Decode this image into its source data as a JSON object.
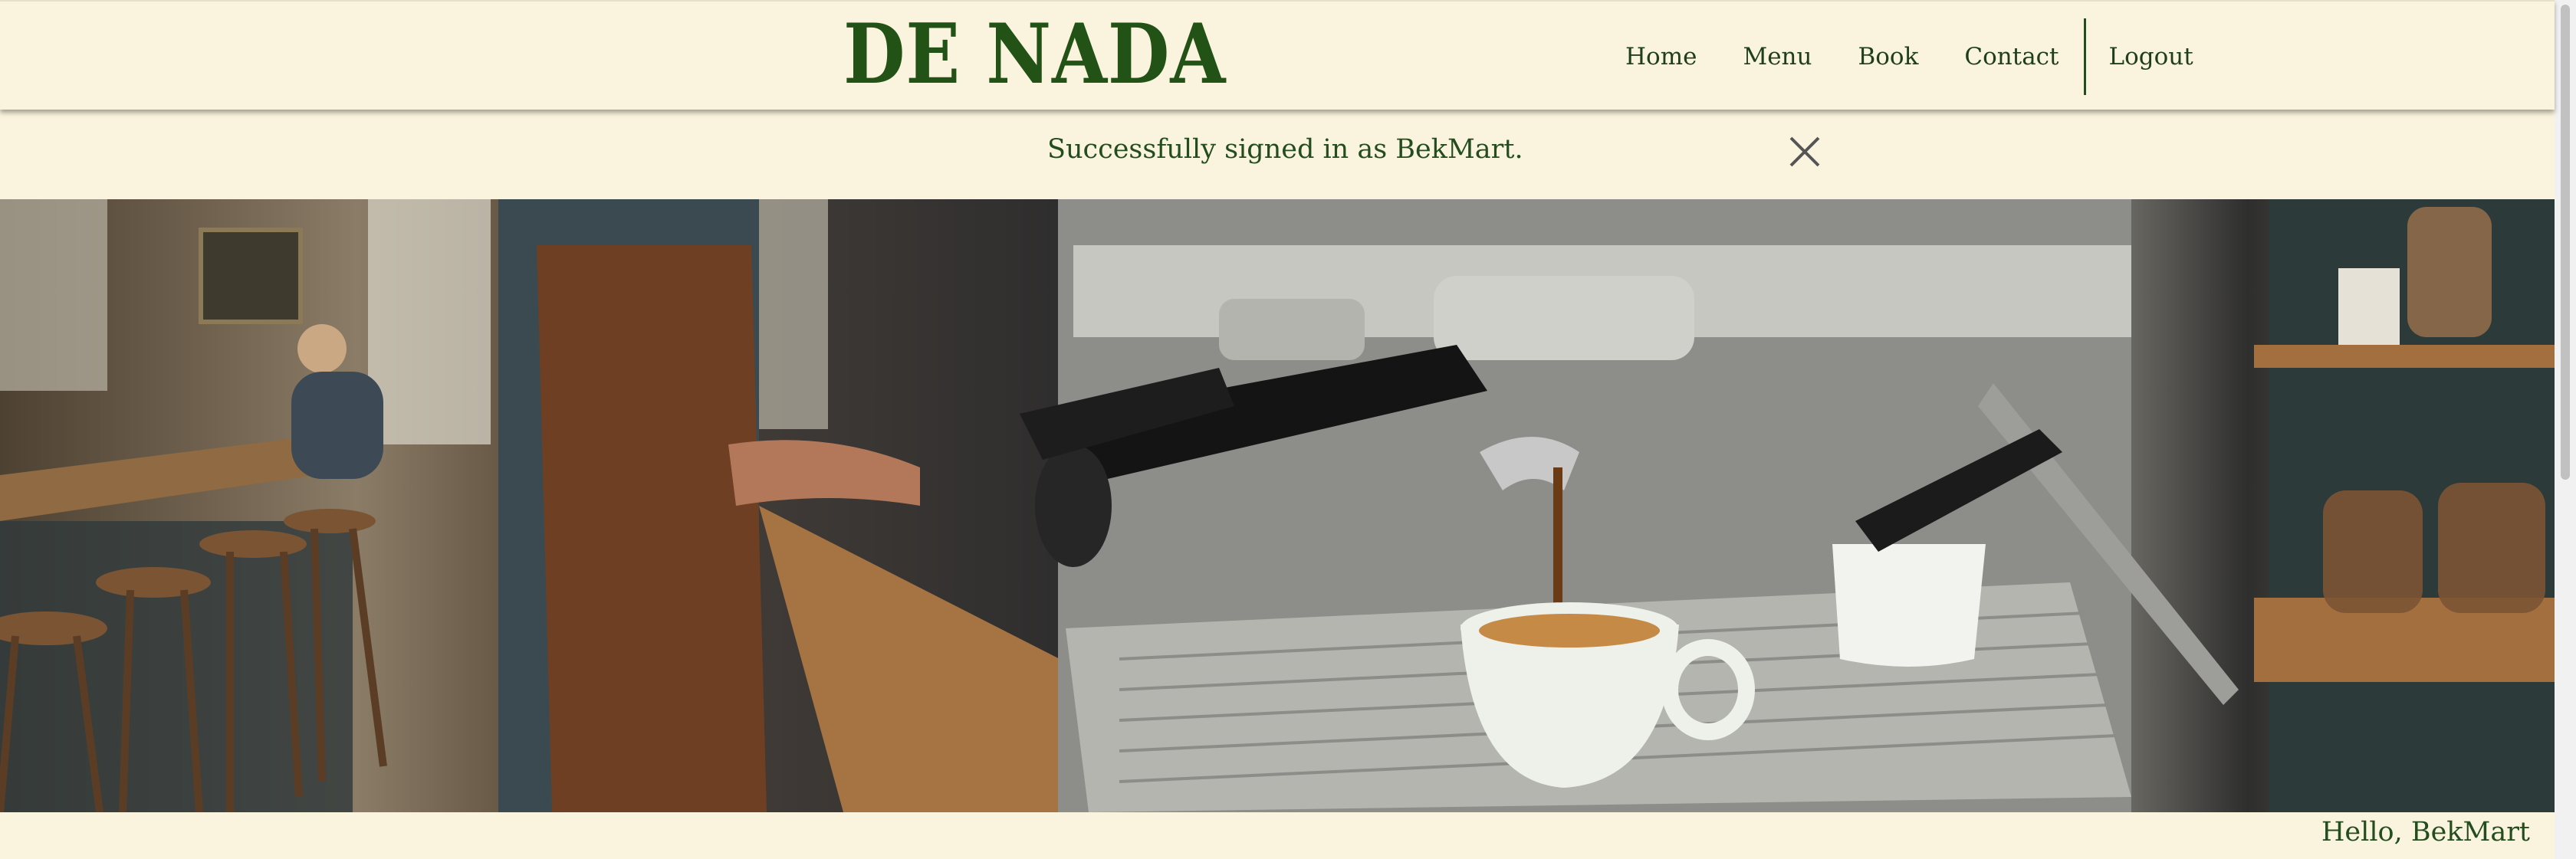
{
  "header": {
    "brand": "DE NADA",
    "nav": [
      {
        "label": "Home"
      },
      {
        "label": "Menu"
      },
      {
        "label": "Book"
      },
      {
        "label": "Contact"
      }
    ],
    "logout_label": "Logout"
  },
  "flash": {
    "message": "Successfully signed in as BekMart.",
    "close_icon": "close-icon"
  },
  "hero": {
    "image_subject": "barista-espresso-machine-photo"
  },
  "footer": {
    "greeting": "Hello, BekMart"
  },
  "colors": {
    "brand_green": "#235217",
    "background_cream": "#faf3dd",
    "text_green": "#234d1f"
  }
}
